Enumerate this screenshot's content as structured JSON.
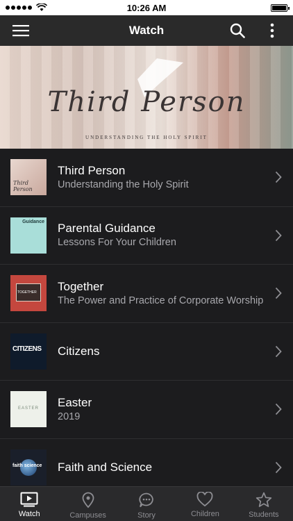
{
  "status_bar": {
    "time": "10:26 AM"
  },
  "nav": {
    "title": "Watch",
    "menu_icon": "hamburger-menu-icon",
    "search_icon": "search-icon",
    "more_icon": "more-vertical-icon"
  },
  "hero": {
    "title": "Third Person",
    "subtitle": "UNDERSTANDING THE HOLY SPIRIT"
  },
  "series": [
    {
      "title": "Third Person",
      "subtitle": "Understanding the Holy Spirit",
      "thumb_text": "Third Person"
    },
    {
      "title": "Parental Guidance",
      "subtitle": "Lessons For Your Children",
      "thumb_text": "Guidance"
    },
    {
      "title": "Together",
      "subtitle": "The Power and Practice of Corporate Worship",
      "thumb_text": "TOGETHER"
    },
    {
      "title": "Citizens",
      "subtitle": "",
      "thumb_text": "CITIZENS"
    },
    {
      "title": "Easter",
      "subtitle": "2019",
      "thumb_text": "EASTER"
    },
    {
      "title": "Faith and Science",
      "subtitle": "",
      "thumb_text": "faith science"
    }
  ],
  "tabs": [
    {
      "label": "Watch",
      "icon": "play-screen-icon",
      "active": true
    },
    {
      "label": "Campuses",
      "icon": "map-pin-icon",
      "active": false
    },
    {
      "label": "Story",
      "icon": "chat-bubble-icon",
      "active": false
    },
    {
      "label": "Children",
      "icon": "heart-icon",
      "active": false
    },
    {
      "label": "Students",
      "icon": "star-icon",
      "active": false
    }
  ],
  "colors": {
    "background": "#1c1c1e",
    "nav": "#2a2a2a",
    "tab_active": "#ffffff",
    "tab_inactive": "#8e8e93"
  }
}
